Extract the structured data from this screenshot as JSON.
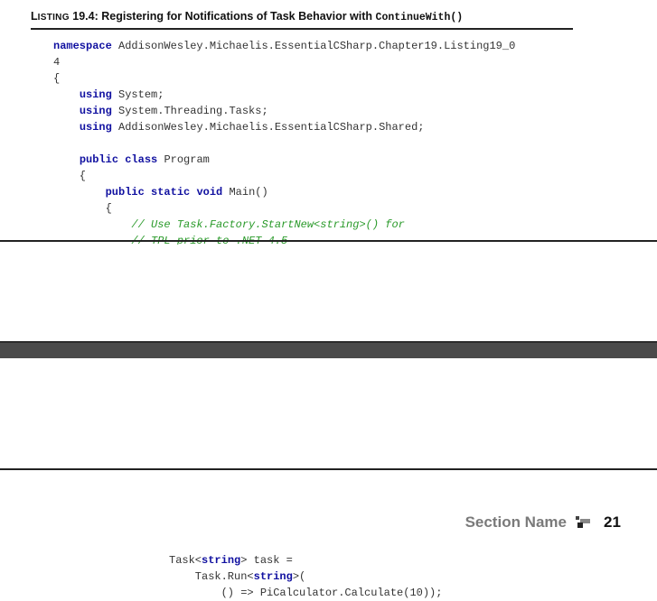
{
  "listing": {
    "label_small_caps_first": "L",
    "label_small_caps_rest": "ISTING",
    "number": "19.4:",
    "title": "Registering for Notifications of Task Behavior with",
    "title_code": "ContinueWith()"
  },
  "code_top": [
    [
      {
        "t": "namespace",
        "c": "kw"
      },
      {
        "t": " AddisonWesley.Michaelis.EssentialCSharp.Chapter19.Listing19_0"
      }
    ],
    [
      {
        "t": "4"
      }
    ],
    [
      {
        "t": "{"
      }
    ],
    [
      {
        "t": "    "
      },
      {
        "t": "using",
        "c": "kw"
      },
      {
        "t": " System;"
      }
    ],
    [
      {
        "t": "    "
      },
      {
        "t": "using",
        "c": "kw"
      },
      {
        "t": " System.Threading.Tasks;"
      }
    ],
    [
      {
        "t": "    "
      },
      {
        "t": "using",
        "c": "kw"
      },
      {
        "t": " AddisonWesley.Michaelis.EssentialCSharp.Shared;"
      }
    ],
    [
      {
        "t": ""
      }
    ],
    [
      {
        "t": "    "
      },
      {
        "t": "public",
        "c": "kw"
      },
      {
        "t": " "
      },
      {
        "t": "class",
        "c": "kw"
      },
      {
        "t": " Program"
      }
    ],
    [
      {
        "t": "    {"
      }
    ],
    [
      {
        "t": "        "
      },
      {
        "t": "public",
        "c": "kw"
      },
      {
        "t": " "
      },
      {
        "t": "static",
        "c": "kw"
      },
      {
        "t": " "
      },
      {
        "t": "void",
        "c": "kw"
      },
      {
        "t": " Main()"
      }
    ],
    [
      {
        "t": "        {"
      }
    ],
    [
      {
        "t": "            "
      },
      {
        "t": "// Use Task.Factory.StartNew<string>() for",
        "c": "cm"
      }
    ],
    [
      {
        "t": "            "
      },
      {
        "t": "// TPL prior to .NET 4.5",
        "c": "cm"
      }
    ]
  ],
  "footer": {
    "section_name": "Section Name",
    "page_number": "21"
  },
  "code_bottom": [
    [
      {
        "t": "Task<"
      },
      {
        "t": "string",
        "c": "kw"
      },
      {
        "t": "> task ="
      }
    ],
    [
      {
        "t": "    Task.Run<"
      },
      {
        "t": "string",
        "c": "kw"
      },
      {
        "t": ">("
      }
    ],
    [
      {
        "t": "        () => PiCalculator.Calculate(10));"
      }
    ]
  ]
}
